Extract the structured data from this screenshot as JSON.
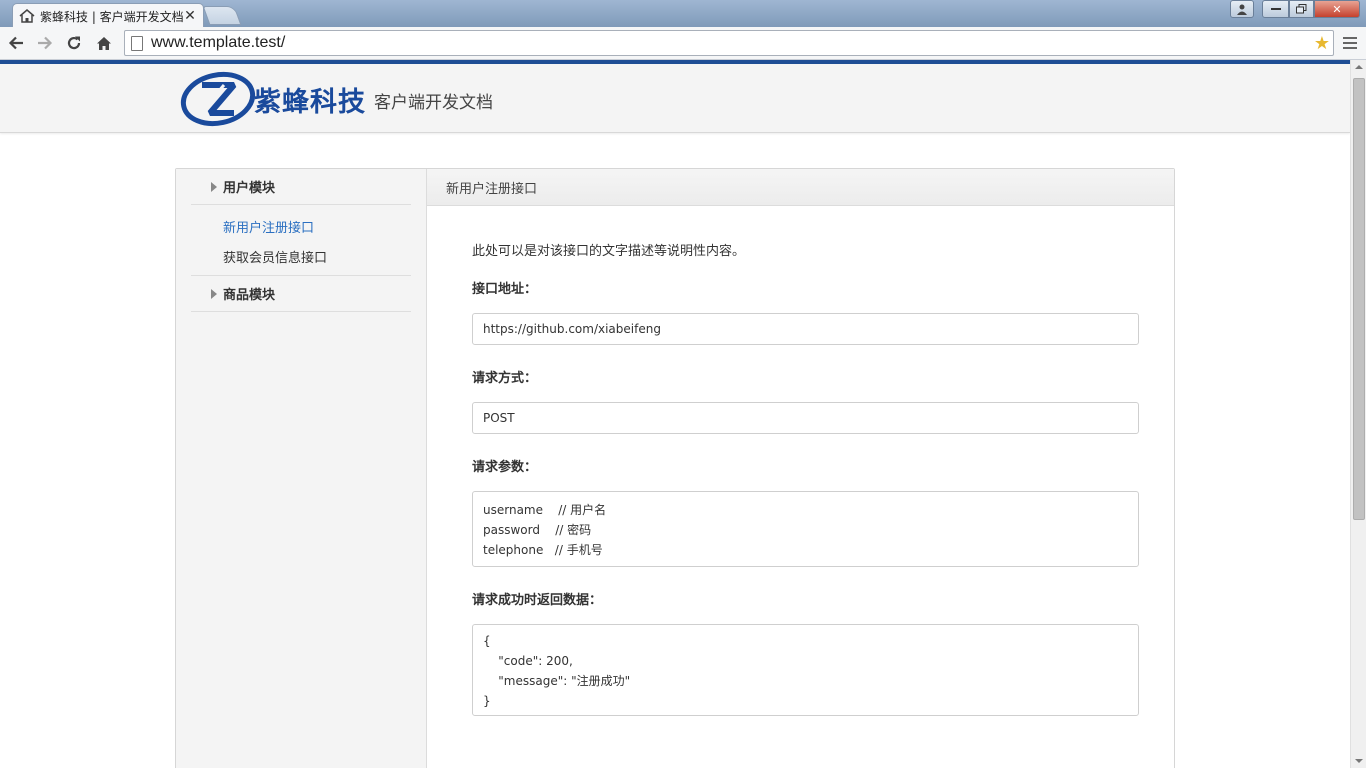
{
  "browser": {
    "tab_title": "紫蜂科技 | 客户端开发文档",
    "url": "www.template.test/",
    "icons": {
      "tab": "home-icon",
      "back": "back-arrow-icon",
      "forward": "forward-arrow-icon",
      "reload": "reload-icon",
      "home": "home-icon",
      "bookmark": "star-icon",
      "menu": "hamburger-menu-icon"
    }
  },
  "header": {
    "brand": "紫蜂科技",
    "subtitle": "客户端开发文档",
    "brand_color": "#1a4a9c"
  },
  "sidebar": {
    "groups": [
      {
        "label": "用户模块",
        "items": [
          {
            "label": "新用户注册接口",
            "active": true
          },
          {
            "label": "获取会员信息接口",
            "active": false
          }
        ]
      },
      {
        "label": "商品模块",
        "items": []
      }
    ],
    "active_color": "#2a6fc1"
  },
  "content": {
    "title": "新用户注册接口",
    "description": "此处可以是对该接口的文字描述等说明性内容。",
    "sections": {
      "url_label": "接口地址：",
      "url_value": "https://github.com/xiabeifeng",
      "method_label": "请求方式：",
      "method_value": "POST",
      "params_label": "请求参数：",
      "params": [
        "username    // 用户名",
        "password    // 密码",
        "telephone   // 手机号"
      ],
      "response_label": "请求成功时返回数据：",
      "response": [
        "{",
        "    \"code\": 200,",
        "    \"message\": \"注册成功\"",
        "}"
      ]
    }
  }
}
